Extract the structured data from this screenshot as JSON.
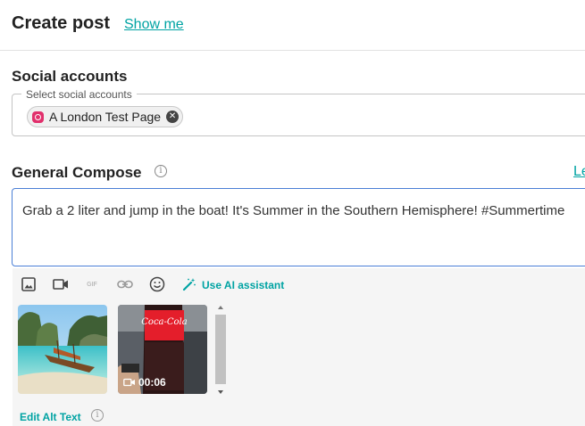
{
  "header": {
    "title": "Create post",
    "show_me_link": "Show me"
  },
  "social_accounts": {
    "section_title": "Social accounts",
    "field_legend": "Select social accounts",
    "selected_accounts": [
      {
        "label": "A London Test Page",
        "network_icon": "instagram-icon"
      }
    ]
  },
  "compose": {
    "section_title": "General Compose",
    "learn_link": "Le",
    "text": "Grab a 2 liter and jump in the boat! It's Summer in the Southern Hemisphere! #Summertime"
  },
  "toolbar": {
    "icons": [
      "image-icon",
      "video-icon",
      "gif-icon",
      "link-icon",
      "emoji-icon",
      "magic-wand-icon"
    ],
    "gif_label": "GIF",
    "ai_label": "Use AI assistant"
  },
  "media": {
    "items": [
      {
        "type": "image",
        "description_icon": "beach-photo"
      },
      {
        "type": "video",
        "duration": "00:06",
        "bottle_label": "Coca-Cola"
      }
    ],
    "edit_alt_label": "Edit Alt Text"
  },
  "colors": {
    "accent": "#00a3a3",
    "focus_border": "#4a7fd6",
    "instagram": "#e1306c",
    "toolbar_bg": "#f5f5f5"
  }
}
